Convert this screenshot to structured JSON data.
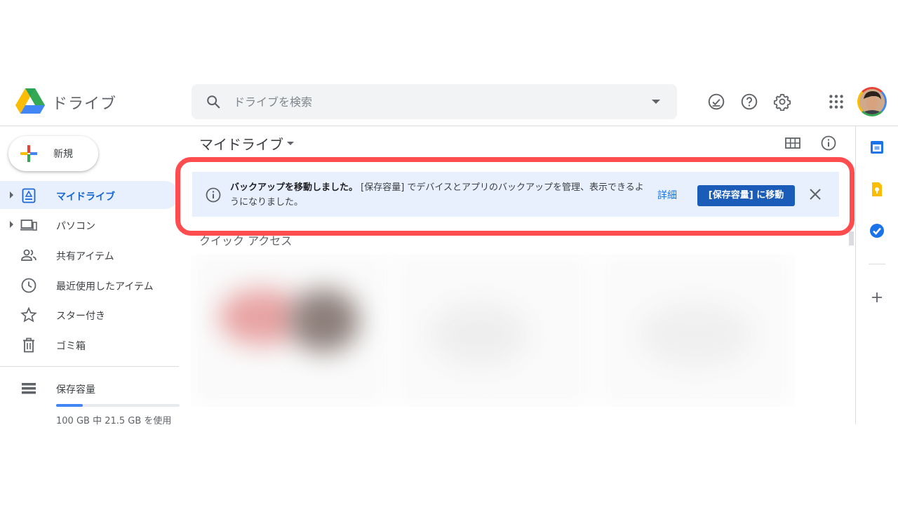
{
  "app": {
    "title": "ドライブ"
  },
  "search": {
    "placeholder": "ドライブを検索"
  },
  "header_icons": [
    "offline-check-icon",
    "help-icon",
    "settings-icon",
    "apps-grid-icon"
  ],
  "sidebar": {
    "new_label": "新規",
    "items": [
      {
        "label": "マイドライブ",
        "icon": "my-drive-icon",
        "active": true,
        "expandable": true
      },
      {
        "label": "パソコン",
        "icon": "computers-icon",
        "active": false,
        "expandable": true
      },
      {
        "label": "共有アイテム",
        "icon": "shared-people-icon",
        "active": false,
        "expandable": false
      },
      {
        "label": "最近使用したアイテム",
        "icon": "clock-icon",
        "active": false,
        "expandable": false
      },
      {
        "label": "スター付き",
        "icon": "star-icon",
        "active": false,
        "expandable": false
      },
      {
        "label": "ゴミ箱",
        "icon": "trash-icon",
        "active": false,
        "expandable": false
      }
    ],
    "storage": {
      "label": "保存容量",
      "usage_text": "100 GB 中 21.5 GB を使用",
      "used_fraction": 0.215
    }
  },
  "main": {
    "breadcrumb": "マイドライブ",
    "banner": {
      "bold_text": "バックアップを移動しました。",
      "text": "[保存容量] でデバイスとアプリのバックアップを管理、表示できるようになりました。",
      "detail_link": "詳細",
      "action_button": "[保存容量] に移動"
    },
    "quick_access_label": "クイック アクセス"
  },
  "colors": {
    "accent": "#1a73e8",
    "highlight_frame": "#ff4d4f",
    "banner_bg": "#e8f0fe",
    "action_button_bg": "#1a5cb8"
  }
}
